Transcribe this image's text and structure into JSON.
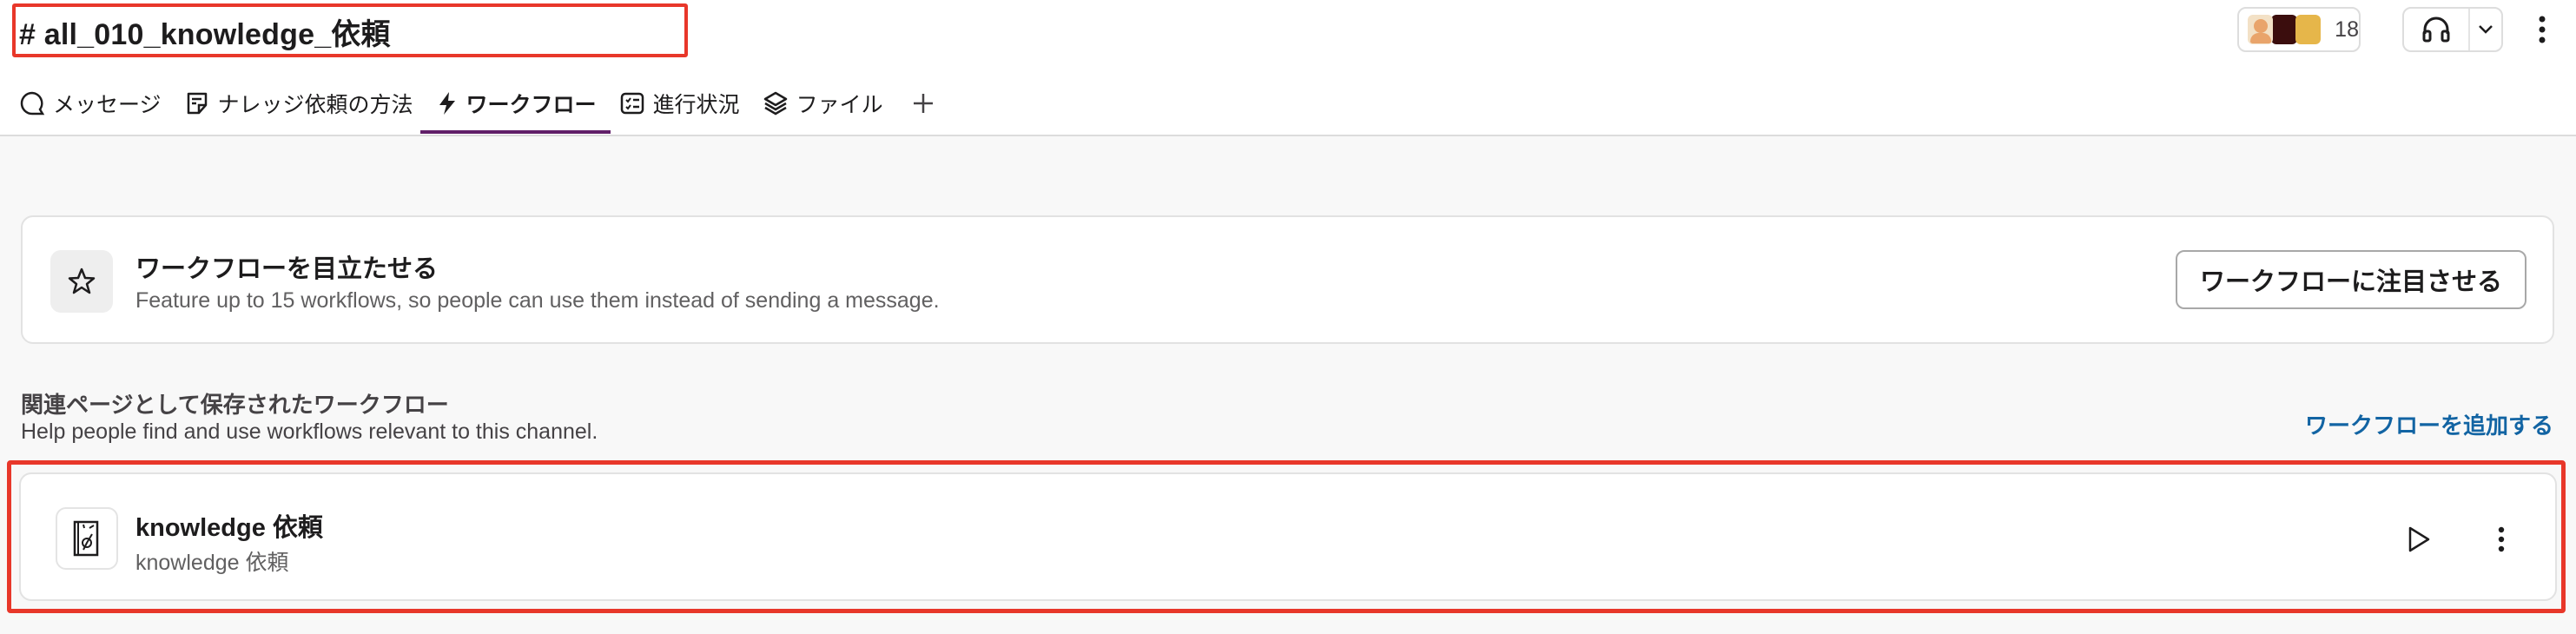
{
  "channel": {
    "title": "# all_010_knowledge_依頼"
  },
  "header": {
    "member_count": "18",
    "accent_color": "#611f69",
    "highlight_color": "#e8372a"
  },
  "tabs": [
    {
      "label": "メッセージ",
      "icon": "chat-bubble-icon"
    },
    {
      "label": "ナレッジ依頼の方法",
      "icon": "canvas-icon"
    },
    {
      "label": "ワークフロー",
      "icon": "lightning-icon",
      "active": true
    },
    {
      "label": "進行状況",
      "icon": "checklist-icon"
    },
    {
      "label": "ファイル",
      "icon": "layers-icon"
    }
  ],
  "feature": {
    "title": "ワークフローを目立たせる",
    "description": "Feature up to 15 workflows, so people can use them instead of sending a message.",
    "button_label": "ワークフローに注目させる",
    "icon": "star-icon"
  },
  "saved_section": {
    "title": "関連ページとして保存されたワークフロー",
    "description": "Help people find and use workflows relevant to this channel.",
    "add_link": "ワークフローを追加する",
    "link_color": "#1264a3"
  },
  "workflows": [
    {
      "title": "knowledge 依頼",
      "subtitle": "knowledge 依頼",
      "icon": "workflow-document-icon"
    }
  ]
}
